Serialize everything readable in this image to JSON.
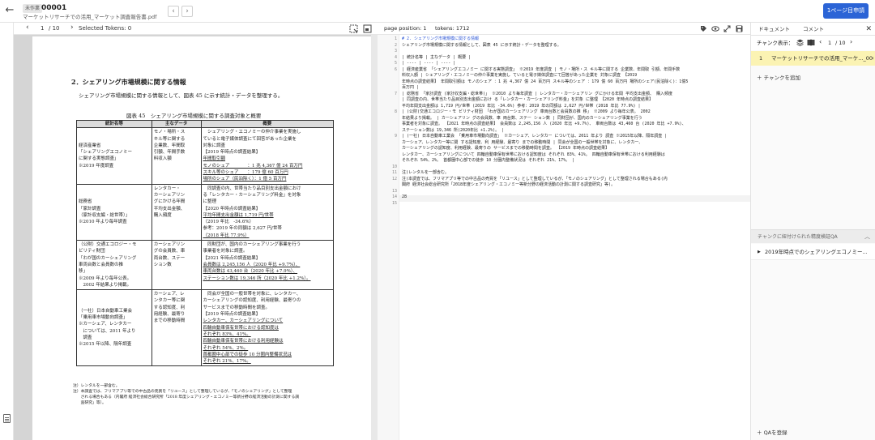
{
  "header": {
    "back_icon": "←",
    "badge": "未作業",
    "code": "00001",
    "filename": "マーケットリサーチでの活用_マーケット調査報告書.pdf",
    "prev_icon": "‹",
    "next_icon": "›",
    "primary_button": "1ページ目申請"
  },
  "pdf_toolbar": {
    "prev": "‹",
    "page": "1",
    "total": "/ 10",
    "next": "›",
    "selected_tokens": "Selected Tokens: 0"
  },
  "pdf_page": {
    "section_title": "2．シェアリング市場規模に関する情報",
    "intro": "シェアリング市場規模に関する情報として、図表 45 に示す統計・データを整理する。",
    "caption": "図表 45　シェアリング市場規模に関する調査対象と概要",
    "table": {
      "headers": [
        "統計名等",
        "主なデータ",
        "概要"
      ],
      "rows": [
        {
          "c1": [
            "経済産業省",
            "「シェアリングエコノミー",
            "に関する実態調査」",
            "※2019 年度調査"
          ],
          "c2": [
            "モノ・場所・ス",
            "キル等に関する",
            "企業数、年間取",
            "引額、年間手数",
            "料収入額"
          ],
          "c3": [
            {
              "t": "　シェアリング・エコノミーの仲介事業を実施し",
              "u": false
            },
            {
              "t": "ていると電子媒体調査にて回答があった企業を",
              "u": false
            },
            {
              "t": "対象に調査",
              "u": false
            },
            {
              "t": "【2019 年時点の調査結果】",
              "u": false
            },
            {
              "t": "年間取引額",
              "u": true
            },
            {
              "t": "モノのシェア　　　　：1 兆 4,367 億 24 百万円",
              "u": true
            },
            {
              "t": "スキル等のシェア　　：179 億 60 百万円",
              "u": true
            },
            {
              "t": "場所のシェア（民泊除く）：1 億 5 百万円",
              "u": true
            }
          ]
        },
        {
          "c1": [
            "総務省",
            "「家計調査",
            "（家計収支編・総世帯）」",
            "※2010 年より毎年調査"
          ],
          "c2": [
            "レンタカー・",
            "カーシェアリン",
            "グにかける年間",
            "平均支出金額、",
            "購入頻度"
          ],
          "c3": [
            {
              "t": "　同調査の内、世帯当たり品目別支出金額におけ",
              "u": false
            },
            {
              "t": "る「レンタカー・カーシェアリング料金」を対象",
              "u": false
            },
            {
              "t": "に整理",
              "u": false
            },
            {
              "t": "【2020 年時点の調査結果】",
              "u": false
            },
            {
              "t": "平均年間支出金額は 1,719 円/世帯",
              "u": true
            },
            {
              "t": "（2019 年比　-34.6%）",
              "u": false
            },
            {
              "t": "参考：2019 年の同額は 2,627 円/世帯",
              "u": false
            },
            {
              "t": "（2018 年比 77.9%）",
              "u": true
            }
          ]
        },
        {
          "c1": [
            "（公財）交通エコロジー・モ",
            "ビリティ財団",
            "「わが国のカーシェアリング",
            "車両台数と会員数の推",
            "移」",
            "※2009 年より毎年公表。",
            "　2002 年結果より掲載。"
          ],
          "c2": [
            "カーシェアリン",
            "グの会員数、車",
            "両台数、ステー",
            "ション数"
          ],
          "c3": [
            {
              "t": "　同財団が、国内のカーシェアリング事業を行う",
              "u": false
            },
            {
              "t": "事業者を対象に調査。",
              "u": false
            },
            {
              "t": "【2021 年時点の調査結果】",
              "u": false
            },
            {
              "t": "会員数は 2,245,156 人（2020 年比 +9.7%）、",
              "u": true
            },
            {
              "t": "車両台数は 43,460 台（2020 年比 +7.9%）、",
              "u": true
            },
            {
              "t": "ステーション数は 19,346 所（2020 年比 +1.2%）。",
              "u": true
            }
          ]
        },
        {
          "c1": [
            "（一社）日本自動車工業会",
            "「乗用車市場動向調査」",
            "※カーシェア、レンタカー",
            "　については、2011 年より",
            "　調査",
            "※2015 年以降、隔年調査"
          ],
          "c2": [
            "カーシェア、レ",
            "ンタカー等に関",
            "する認知度、利",
            "用経験、最寄り",
            "までの移動時間"
          ],
          "c3": [
            {
              "t": "　同会が全国の一般世帯を対象に、レンタカー、",
              "u": false
            },
            {
              "t": "カーシェアリングの認知度、利用経験、最寄りの",
              "u": false
            },
            {
              "t": "サービスまでの移動時間を調査。",
              "u": false
            },
            {
              "t": "【2019 年時点の調査結果】",
              "u": false
            },
            {
              "t": "レンタカー、カーシェアリングについて",
              "u": true
            },
            {
              "t": "四輪自動車保有世帯における認知度は",
              "u": true
            },
            {
              "t": "それぞれ 83%、41%。",
              "u": true
            },
            {
              "t": "四輪自動車保有世帯における利用経験は",
              "u": true
            },
            {
              "t": "それぞれ 54%、2%。",
              "u": true
            },
            {
              "t": "首都圏中心部での徒歩 10 分圏内整備状況は",
              "u": true
            },
            {
              "t": "それぞれ 21%、17%。",
              "u": true
            }
          ]
        }
      ]
    },
    "footnotes": [
      "注）レンタルを一部含む。",
      "注）本調査では、フリマアプリ等での中古品の売買を「リユース」として整理しているが、「モノのシェアリング」として整理",
      "　　される場合もある（内閣府 経済社会総合研究所「2018 年度シェアリング・エコノミー等新分野の経済活動の計測に関する調",
      "　　査研究」等）。"
    ]
  },
  "editor_toolbar": {
    "page_position": "page position:  1",
    "tokens": "tokens: 1712",
    "icons": [
      "tag-icon",
      "eye-icon",
      "expand-icon",
      "save-icon"
    ]
  },
  "editor": {
    "lines": [
      {
        "n": "1",
        "t": "# 2. シェアリング市場規模に関する情報",
        "h": true
      },
      {
        "n": "2",
        "t": "シェアリング市場規模に関する情報として、図表 45 に示す統計・データを整理する。",
        "h": false
      },
      {
        "n": "3",
        "t": "",
        "h": false
      },
      {
        "n": "4",
        "t": "| 統計名等 | 主なデータ | 概要 |",
        "h": false
      },
      {
        "n": "5",
        "t": "| ---- | ---- | ---- |",
        "h": false
      },
      {
        "n": "6",
        "t": "| 経済産業省 「シェアリングエコノミー に関する実態調査」 ※2019 年度調査 | モノ・場所・ス キル等に関する 企業数、年間取 引額、年間手数",
        "h": false
      },
      {
        "n": "",
        "t": "料収入額 | シェアリング・エコノミーの仲介事業を実施し ていると電子媒体調査にて回答があった企業を 対象に調査 【2019",
        "h": false
      },
      {
        "n": "",
        "t": "年時点の調査結果】 年間取引額は モノのシェア ：1 兆 4,367 億 24 百万円 スキル等のシェア ：179 億 60 百万円 場所のシェア(民泊除く)：1億5",
        "h": false
      },
      {
        "n": "",
        "t": "百万円 |",
        "h": false
      },
      {
        "n": "7",
        "t": "| 総務省 「家計調査 (家計収支編・総世帯)」 ※2010 より毎年調査 | レンタカー・カーシェアリン グにかける年間 平均支出金額、 購入頻度",
        "h": false
      },
      {
        "n": "",
        "t": "| 同調査の内、世帯当たり品目別支出金額におけ る「レンタカー・カーシェアリング料金」を対象 に整理 【2020 年時点の調査結果】",
        "h": false
      },
      {
        "n": "",
        "t": "平均年間支出金額は 1,719 円/世帯 (2019 年比 -34.6%) 参考：2019 年の同額は 2,627 円/世帯 (2018 年比 77.9%) |",
        "h": false
      },
      {
        "n": "8",
        "t": "| (公財)交通エコロジー・モ ビリティ財団 「わが国のカーシェアリング 車両台数と会員数の推 移」 ※2009 より毎年公表。 2002",
        "h": false
      },
      {
        "n": "",
        "t": "年結果より掲載。 | カーシェアリン グの会員数、車 両台数、ステー ション数 | 同財団が、国内のカーシェアリング事業を行う",
        "h": false
      },
      {
        "n": "",
        "t": "事業者を対象に調査。 【2021 年時点の調査結果】 会員数は 2,245,156 人 (2020 年比 +9.7%)、 車両台数は 43,460 台 (2020 年比 +7.9%)、",
        "h": false
      },
      {
        "n": "",
        "t": "ステーション数は 19,346 所(2020年比 +1.2%)。 |",
        "h": false
      },
      {
        "n": "9",
        "t": "| (一社) 日本自動車工業会 「乗用車市場動向調査」 ※カーシェア、レンタカー については、2011 年より 調査 ※2015年以降、隔年調査 |",
        "h": false
      },
      {
        "n": "",
        "t": "カーシェア、レンタカー等に関 する認知度、利 用経験、最寄り までの移動時間 | 同会が全国の一般世帯を対象に、レンタカー、",
        "h": false
      },
      {
        "n": "",
        "t": "カーシェアリングの認知度、利用経験、最寄りの サービスまでの移動時間を調査。 【2019 年時点の調査結果】",
        "h": false
      },
      {
        "n": "",
        "t": "レンタカー、カーシェアリングについて 四輪自動車保有世帯における認知度は それぞれ 83%、41%。 四輪自動車保有世帯における利用経験は",
        "h": false
      },
      {
        "n": "",
        "t": "それぞれ 54%、2%。 首都圏中心部での徒歩 10 分圏内整備状況は それぞれ 21%、17%。 |",
        "h": false
      },
      {
        "n": "10",
        "t": "",
        "h": false
      },
      {
        "n": "11",
        "t": "注)レンタルを一部含む。",
        "h": false
      },
      {
        "n": "12",
        "t": "注)本調査では、フリマアプリ等での中古品の売買を「リユース」として整理しているが、「モノのシェアリング」として整理される場合もある(内",
        "h": false
      },
      {
        "n": "",
        "t": "閣府 経済社会総合研究所「2018年度シェアリング・エコノミー等新分野の経済活動の計測に関する調査研究」等)。",
        "h": false
      },
      {
        "n": "13",
        "t": "",
        "h": false
      },
      {
        "n": "14",
        "t": "28",
        "h": false
      },
      {
        "n": "15",
        "t": "",
        "h": false
      }
    ]
  },
  "right_panel": {
    "tab_document": "ドキュメント",
    "tab_comment": "コメント",
    "close_icon": "✕",
    "chunk_display_label": "チャンク表示：",
    "chunk_page": "1",
    "chunk_total": "/ 10",
    "prev": "‹",
    "next": "›",
    "chunk": {
      "number": "1",
      "name": "マーケットリサーチでの活用_マーケ..._000"
    },
    "add_chunk": "＋  チャンクを追加",
    "qa_header": "チャンクに紐付けられた精度検証QA",
    "qa_chevron": "︿",
    "qa_items": [
      {
        "arrow": "▶",
        "text": "2019年時点でのシェアリングエコノミー..."
      }
    ],
    "add_qa": "＋  QAを登録"
  }
}
